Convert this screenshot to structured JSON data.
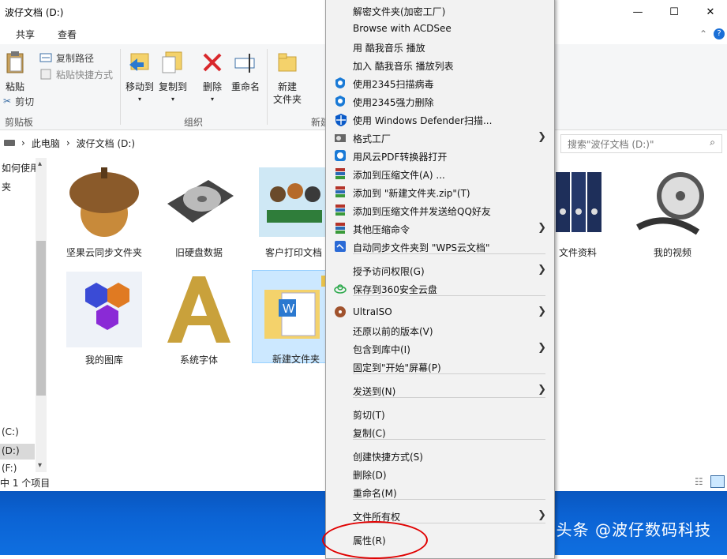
{
  "window": {
    "title": "波仔文档 (D:)",
    "min": "—",
    "max": "☐",
    "close": "✕"
  },
  "tabs": [
    "共享",
    "查看"
  ],
  "ribbon": {
    "paste": "粘贴",
    "copy_path": "复制路径",
    "paste_shortcut": "粘贴快捷方式",
    "cut": "剪切",
    "clipboard_group": "剪贴板",
    "move_to": "移动到",
    "copy_to": "复制到",
    "delete": "删除",
    "rename": "重命名",
    "organize_group": "组织",
    "new_folder_line1": "新建",
    "new_folder_line2": "文件夹",
    "new_group": "新建"
  },
  "address": {
    "pc": "此电脑",
    "sep": "›",
    "drive": "波仔文档 (D:)"
  },
  "search": {
    "placeholder": "搜索\"波仔文档 (D:)\""
  },
  "nav": {
    "items": [
      "如何使用",
      "夹",
      "(C:)",
      "(D:)",
      "(F:)"
    ]
  },
  "files": [
    {
      "name": "坚果云同步文件夹"
    },
    {
      "name": "旧硬盘数据"
    },
    {
      "name": "客户打印文档"
    },
    {
      "name": "文件资料"
    },
    {
      "name": "我的视频"
    },
    {
      "name": "我的图库"
    },
    {
      "name": "系统字体"
    },
    {
      "name": "新建文件夹"
    }
  ],
  "status": {
    "text": "中 1 个项目"
  },
  "watermark": "头条 @波仔数码科技",
  "menu": {
    "items": [
      {
        "label": "解密文件夹(加密工厂)",
        "icon": "none",
        "arrow": false
      },
      {
        "label": "Browse with ACDSee",
        "icon": "none",
        "arrow": false
      },
      {
        "label": "用 酷我音乐 播放",
        "icon": "none",
        "arrow": false
      },
      {
        "label": "加入 酷我音乐 播放列表",
        "icon": "none",
        "arrow": false
      },
      {
        "label": "使用2345扫描病毒",
        "icon": "shield-2345-icon",
        "arrow": false
      },
      {
        "label": "使用2345强力删除",
        "icon": "shield-2345-icon",
        "arrow": false
      },
      {
        "label": "使用 Windows Defender扫描...",
        "icon": "defender-icon",
        "arrow": false
      },
      {
        "label": "格式工厂",
        "icon": "format-factory-icon",
        "arrow": true
      },
      {
        "label": "用风云PDF转换器打开",
        "icon": "pdf-converter-icon",
        "arrow": false
      },
      {
        "label": "添加到压缩文件(A) ...",
        "icon": "winrar-icon",
        "arrow": false
      },
      {
        "label": "添加到 \"新建文件夹.zip\"(T)",
        "icon": "winrar-icon",
        "arrow": false
      },
      {
        "label": "添加到压缩文件并发送给QQ好友",
        "icon": "winrar-icon",
        "arrow": false
      },
      {
        "label": "其他压缩命令",
        "icon": "winrar-icon",
        "arrow": true
      },
      {
        "label": "自动同步文件夹到 \"WPS云文档\"",
        "icon": "wps-cloud-icon",
        "arrow": false
      },
      {
        "label": "授予访问权限(G)",
        "icon": "none",
        "arrow": true
      },
      {
        "label": "保存到360安全云盘",
        "icon": "cloud-360-icon",
        "arrow": false
      },
      {
        "label": "UltraISO",
        "icon": "ultraiso-icon",
        "arrow": true
      },
      {
        "label": "还原以前的版本(V)",
        "icon": "none",
        "arrow": false
      },
      {
        "label": "包含到库中(I)",
        "icon": "none",
        "arrow": true
      },
      {
        "label": "固定到\"开始\"屏幕(P)",
        "icon": "none",
        "arrow": false
      },
      {
        "label": "发送到(N)",
        "icon": "none",
        "arrow": true
      },
      {
        "label": "剪切(T)",
        "icon": "none",
        "arrow": false
      },
      {
        "label": "复制(C)",
        "icon": "none",
        "arrow": false
      },
      {
        "label": "创建快捷方式(S)",
        "icon": "none",
        "arrow": false
      },
      {
        "label": "删除(D)",
        "icon": "none",
        "arrow": false
      },
      {
        "label": "重命名(M)",
        "icon": "none",
        "arrow": false
      },
      {
        "label": "文件所有权",
        "icon": "none",
        "arrow": true
      },
      {
        "label": "属性(R)",
        "icon": "none",
        "arrow": false
      }
    ]
  },
  "colors": {
    "accent": "#0b63d4",
    "highlight": "#e00000",
    "selection": "#cce8ff"
  }
}
